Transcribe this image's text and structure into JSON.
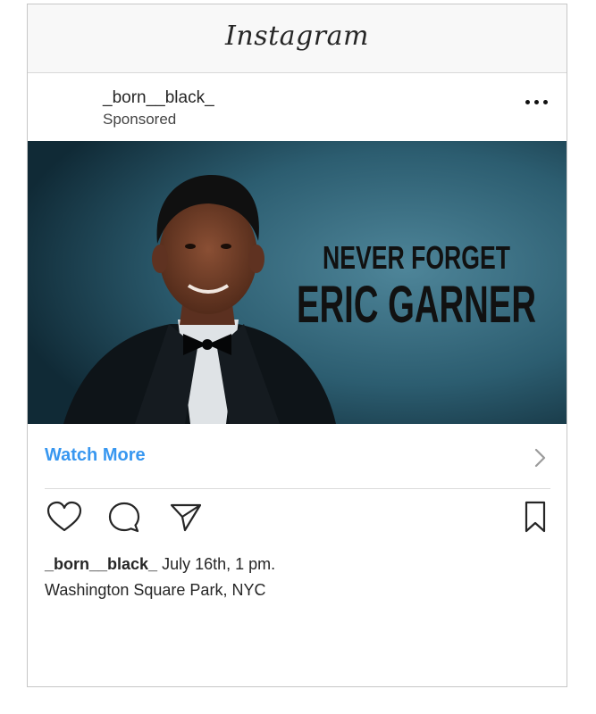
{
  "app": {
    "title": "Instagram"
  },
  "post": {
    "username": "_born__black_",
    "sponsored_label": "Sponsored",
    "image": {
      "line1": "NEVER FORGET",
      "line2": "ERIC GARNER"
    },
    "cta_label": "Watch More",
    "caption_username": "_born__black_",
    "caption_text": "July 16th, 1 pm.",
    "location": "Washington Square Park, NYC"
  },
  "icons": {
    "more": "more-options-icon",
    "like": "heart-icon",
    "comment": "comment-icon",
    "share": "share-icon",
    "save": "bookmark-icon",
    "cta": "chevron-right-icon"
  },
  "colors": {
    "link": "#3897f0",
    "image_bg": "#2a5a6e",
    "headline": "#111111"
  }
}
